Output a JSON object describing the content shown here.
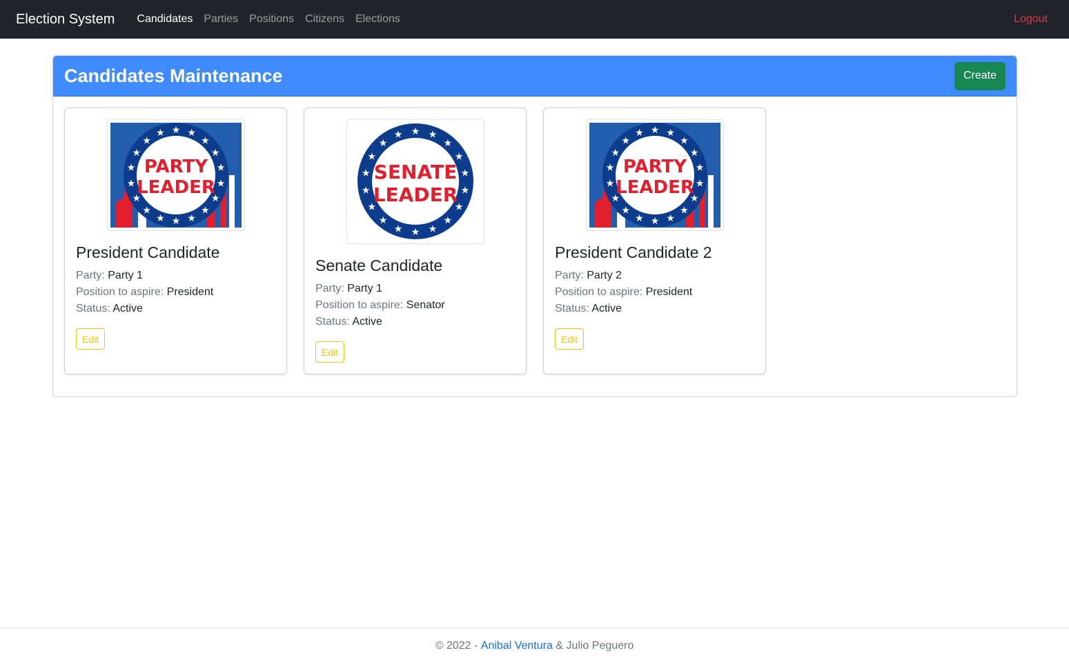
{
  "navbar": {
    "brand": "Election System",
    "links": [
      "Candidates",
      "Parties",
      "Positions",
      "Citizens",
      "Elections"
    ],
    "active": "Candidates",
    "logout": "Logout"
  },
  "page": {
    "title": "Candidates Maintenance",
    "create_label": "Create"
  },
  "labels": {
    "party": "Party:",
    "position": "Position to aspire:",
    "status": "Status:",
    "edit": "Edit"
  },
  "candidates": [
    {
      "name": "President Candidate",
      "party": "Party 1",
      "position": "President",
      "status": "Active",
      "badge_line1": "PARTY",
      "badge_line2": "LEADER"
    },
    {
      "name": "Senate Candidate",
      "party": "Party 1",
      "position": "Senator",
      "status": "Active",
      "badge_line1": "SENATE",
      "badge_line2": "LEADER"
    },
    {
      "name": "President Candidate 2",
      "party": "Party 2",
      "position": "President",
      "status": "Active",
      "badge_line1": "PARTY",
      "badge_line2": "LEADER"
    }
  ],
  "footer": {
    "prefix": "© 2022 - ",
    "author1": "Anibal Ventura",
    "separator": " & ",
    "author2": "Julio Peguero"
  },
  "colors": {
    "navbar_bg": "#212529",
    "header_bg": "#3f8bfd",
    "create_btn": "#198754",
    "edit_btn": "#ffc107",
    "logout": "#dc3545",
    "link": "#0d6efd",
    "badge_blue": "#0d3c8c",
    "badge_red": "#e31e2d"
  }
}
